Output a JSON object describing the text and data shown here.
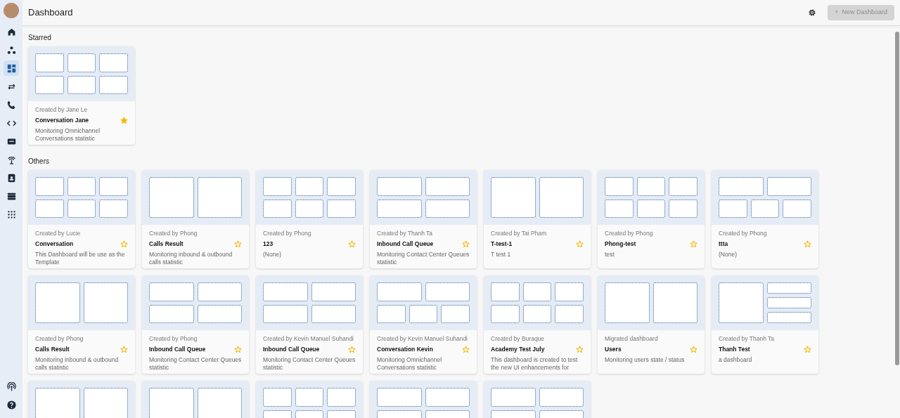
{
  "sidebar": {
    "items": [
      {
        "kind": "home",
        "selected": false
      },
      {
        "kind": "nodes",
        "selected": false
      },
      {
        "kind": "dashboard",
        "selected": true
      },
      {
        "kind": "arrows",
        "selected": false
      },
      {
        "kind": "phone",
        "selected": false
      },
      {
        "kind": "code",
        "selected": false
      },
      {
        "kind": "sms",
        "selected": false
      },
      {
        "kind": "antenna",
        "selected": false
      },
      {
        "kind": "contact",
        "selected": false
      },
      {
        "kind": "database",
        "selected": false
      },
      {
        "kind": "apps",
        "selected": false
      }
    ],
    "bottom_items": [
      {
        "kind": "broadcast",
        "selected": false
      },
      {
        "kind": "help",
        "selected": false
      }
    ]
  },
  "header": {
    "title": "Dashboard",
    "new_button": {
      "icon": "+",
      "label": "New Dashboard",
      "disabled": true
    }
  },
  "sections": [
    {
      "title": "Starred",
      "cards": [
        {
          "kind": "six",
          "creator": "Created by Jane Le",
          "title": "Conversation Jane",
          "description": "Monitoring Omnichannel Conversations statistic",
          "starred": true
        }
      ]
    },
    {
      "title": "Others",
      "cards": [
        {
          "kind": "six",
          "creator": "Created by Lucie",
          "title": "Conversation",
          "description": "This Dashboard will be use as the Template",
          "starred": false
        },
        {
          "kind": "two",
          "creator": "Created by Phong",
          "title": "Calls Result",
          "description": "Monitoring inbound & outbound calls statistic",
          "starred": false
        },
        {
          "kind": "six",
          "creator": "Created by Phong",
          "title": "123",
          "description": "(None)",
          "starred": false
        },
        {
          "kind": "four",
          "creator": "Created by Thanh Ta",
          "title": "Inbound Call Queue",
          "description": "Monitoring Contact Center Queues statistic",
          "starred": false
        },
        {
          "kind": "two",
          "creator": "Created by Tai Pham",
          "title": "T-test-1",
          "description": "T test 1",
          "starred": false
        },
        {
          "kind": "six",
          "creator": "Created by Phong",
          "title": "Phong-test",
          "description": "test",
          "starred": false
        },
        {
          "kind": "twothree",
          "creator": "Created by Phong",
          "title": "ttta",
          "description": "(None)",
          "starred": false
        },
        {
          "kind": "two",
          "creator": "Created by Phong",
          "title": "Calls Result",
          "description": "Monitoring inbound & outbound calls statistic",
          "starred": false
        },
        {
          "kind": "four",
          "creator": "Created by Phong",
          "title": "Inbound Call Queue",
          "description": "Monitoring Contact Center Queues statistic",
          "starred": false
        },
        {
          "kind": "four",
          "creator": "Created by Kevin Manuel Suhandi",
          "title": "Inbound Call Queue",
          "description": "Monitoring Contact Center Queues statistic",
          "starred": false
        },
        {
          "kind": "twothree",
          "creator": "Created by Kevin Manuel Suhandi",
          "title": "Conversation Kevin",
          "description": "Monitoring Omnichannel Conversations statistic",
          "starred": false
        },
        {
          "kind": "six",
          "creator": "Created by Buraque",
          "title": "Academy Test July",
          "description": "This dashboard is created to test the new UI enhancements for",
          "starred": false
        },
        {
          "kind": "two",
          "creator": "Migrated dashboard",
          "title": "Users",
          "description": "Monitoring users state / status",
          "starred": false
        },
        {
          "kind": "onethree",
          "creator": "Created by Thanh Ta",
          "title": "Thanh Test",
          "description": "a dashboard",
          "starred": false
        },
        {
          "kind": "two"
        },
        {
          "kind": "two"
        },
        {
          "kind": "six"
        },
        {
          "kind": "four"
        },
        {
          "kind": "four"
        }
      ]
    }
  ]
}
